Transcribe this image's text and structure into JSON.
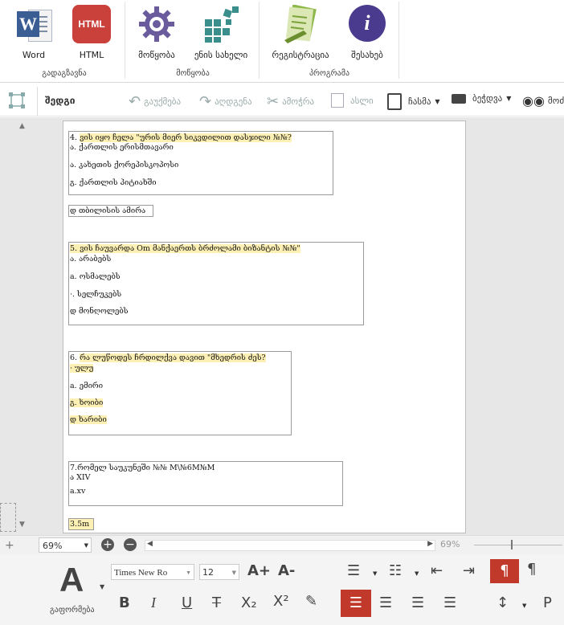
{
  "ribbon": {
    "groups": [
      {
        "label": "გადაგზავნა",
        "buttons": [
          {
            "label": "Word",
            "icon": "word-icon"
          },
          {
            "label": "HTML",
            "icon": "html-icon"
          }
        ]
      },
      {
        "label": "მოწყობა",
        "buttons": [
          {
            "label": "მოწყობა",
            "icon": "gear-icon"
          },
          {
            "label": "ენის სახელი",
            "icon": "blocks-icon"
          }
        ]
      },
      {
        "label": "პროგრამა",
        "buttons": [
          {
            "label": "რეგისტრაცია",
            "icon": "register-icon"
          },
          {
            "label": "შესახებ",
            "icon": "info-icon"
          }
        ]
      }
    ],
    "word_icon_text": "W",
    "html_icon_text": "HTML",
    "info_icon_text": "i"
  },
  "toolbar": {
    "title": "შედგი",
    "undo": "გაუქმება",
    "redo": "აღდგენა",
    "cut": "ამოჭრა",
    "copy": "ასლი",
    "paste": "ჩასმა",
    "print": "ბეჭდვა",
    "find": "მოძ"
  },
  "document": {
    "q4": {
      "question": "ვის იყო ჩელა \"ურის მიერ სიკვდილით დასჯილი №№?",
      "question_prefix": "4.",
      "a": "ა. ქართლის ერისმთავარი",
      "b": "ა. კახეთის ქორეპისკოპოსი",
      "c": "გ. ქართლის პიტიახში"
    },
    "q4_answer": "დ თბილისის ამირა",
    "q5": {
      "question": "5. ვის ჩაუვარდა Om მანქაერთს ბრძოლამი ბიზანტის №№\"",
      "a": "ა. არაბებს",
      "b": "a. ოსმალებს",
      "c": "·. სელჩუკებს",
      "d": "დ მონღოლებს"
    },
    "q6": {
      "question": "რა ლუწოდეს ჩრდილქვა დავით \"მხედრის ძეს?",
      "question_prefix": "6.",
      "a": "· ულუ",
      "b": "a. ემირი",
      "c": "გ. ხოიბი",
      "d": "დ ხარიბი"
    },
    "q7": {
      "question": "7.რომელ საუკუნეში №№ M\\№6M№M",
      "a": "ა XIV",
      "b": "a.xv"
    },
    "bottom_text": "3.5m"
  },
  "status": {
    "zoom": "69%",
    "zoom_right": "69%"
  },
  "format": {
    "styles_label": "გაფორმება",
    "font_name": "Times New Ro",
    "font_size": "12",
    "big_A": "A",
    "grow": "A+",
    "shrink": "A-",
    "bold": "B",
    "italic": "I",
    "underline": "U",
    "strike": "T",
    "sub": "X₂",
    "sup": "X²",
    "p": "P"
  },
  "colors": {
    "accent": "#c0392b",
    "highlight": "#fdf0b4",
    "teal": "#3a8f8c",
    "purple": "#4b3b8f"
  }
}
